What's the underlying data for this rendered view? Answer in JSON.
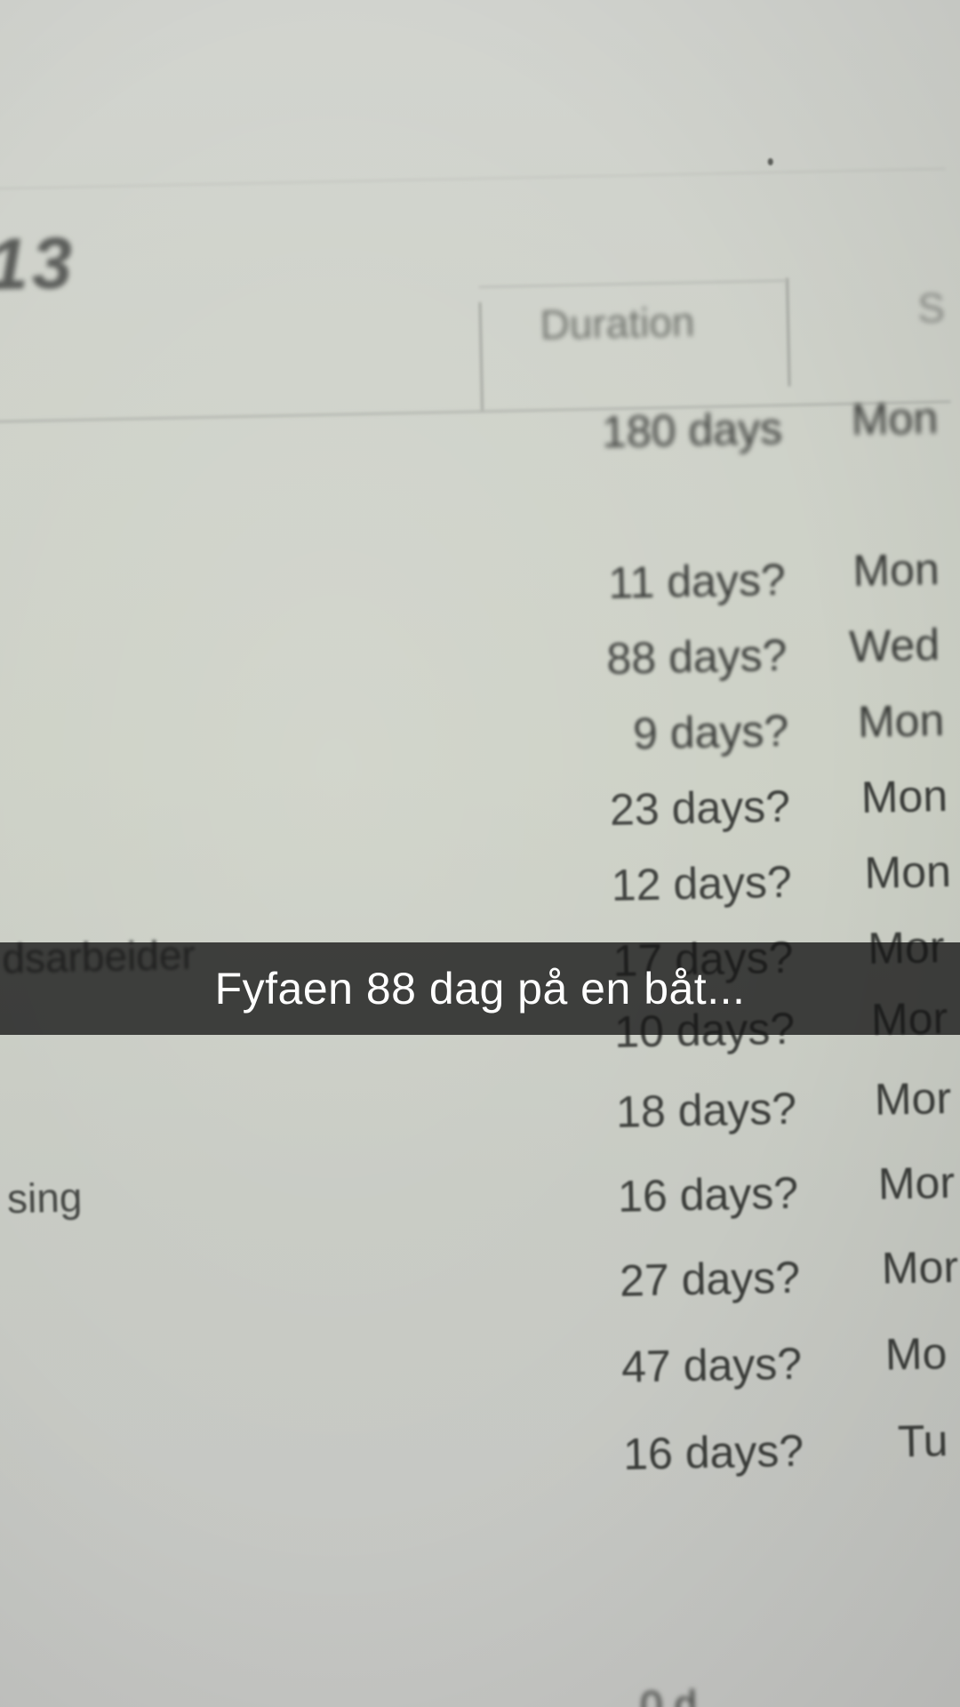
{
  "document": {
    "page_number": "13",
    "column_header": "Duration",
    "column_header_cut": "S",
    "rows": [
      {
        "duration": "180 days",
        "day": "Mon"
      },
      {
        "duration": "11 days?",
        "day": "Mon"
      },
      {
        "duration": "88 days?",
        "day": "Wed"
      },
      {
        "duration": "9 days?",
        "day": "Mon"
      },
      {
        "duration": "23 days?",
        "day": "Mon"
      },
      {
        "duration": "12 days?",
        "day": "Mon"
      },
      {
        "duration": "17 days?",
        "day": "Mor"
      },
      {
        "duration": "10 days?",
        "day": "Mor"
      },
      {
        "duration": "18 days?",
        "day": "Mor"
      },
      {
        "duration": "16 days?",
        "day": "Mor"
      },
      {
        "duration": "27 days?",
        "day": "Mor"
      },
      {
        "duration": "47 days?",
        "day": "Mo"
      },
      {
        "duration": "16 days?",
        "day": "Tu"
      }
    ],
    "left_fragments": [
      "dsarbeider",
      "sing"
    ],
    "bottom_fragment": "0 d"
  },
  "caption": {
    "text": "Fyfaen 88 dag på en båt..."
  }
}
